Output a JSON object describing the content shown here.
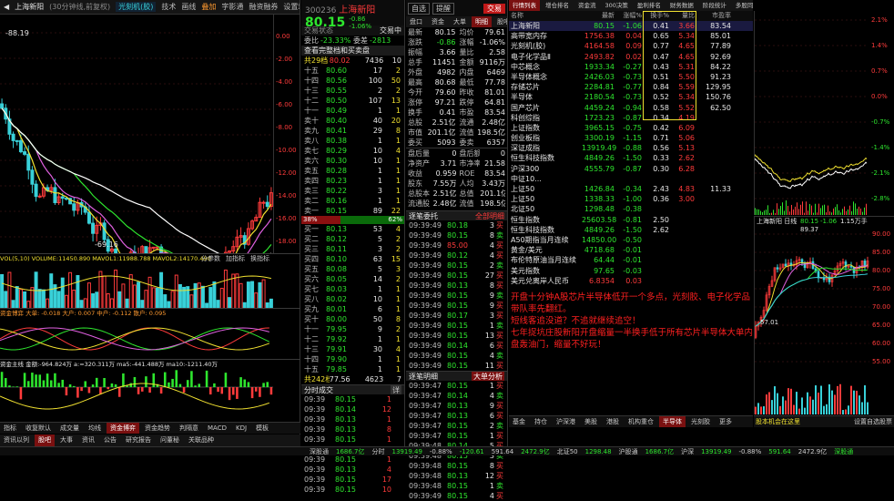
{
  "colors": {
    "up": "#ff3b3b",
    "down": "#2ee62e",
    "bg": "#000000",
    "accent": "#7a1010",
    "notes": "#ff2020"
  },
  "left": {
    "toolbar": [
      "上海新阳",
      "(30分钟线,前复权)",
      "光刻机(胶)",
      "技术",
      "画线",
      "叠加",
      "字影通",
      "融资融券",
      "设置均线"
    ],
    "toolbar_left_tab": "上海新阳",
    "kline_top_label": "-88.19",
    "kline_low_label": "-69.16",
    "right_axis": [
      "0.00",
      "-2.00",
      "-4.00",
      "-6.00",
      "-8.00",
      "-10.00",
      "-12.00",
      "-14.00",
      "-16.00",
      "-18.00"
    ],
    "vol_header": "VOL(5,10)  VOLUME:11450.890  MAVOL1:11988.788  MAVOL2:14170.490",
    "vol_axis": [
      "50000",
      "40000",
      "30000",
      "20000",
      "10000"
    ],
    "vol_buttons": [
      "分参数",
      "加指标",
      "换指标"
    ],
    "flow_header": "资金博弈  大单: -0.018  大户: 0.007  中户: -0.112  散户: 0.095",
    "flow_axis": [
      "3000",
      "2000",
      "1000",
      "0",
      "-1000",
      "-2000"
    ],
    "amt_header": "资金主线  金额:-964.824万  a:=320.311万  ma5:-441.488万  ma10:-1211.40万",
    "amt_axis": [
      "1000",
      "0",
      "-1000",
      "-2000",
      "-3000",
      "-4000",
      "-4610.00"
    ],
    "bottom_tabs": [
      "指标",
      "收复默认",
      "成交量",
      "均线",
      "资金博弈",
      "资金趋势",
      "判隔意",
      "MACD",
      "KDJ",
      "模板"
    ],
    "bottom_nav": [
      "资讯以列",
      "股吧",
      "大事",
      "资讯",
      "公告",
      "研究报告",
      "问董秘",
      "关联品种"
    ]
  },
  "quote": {
    "code": "300236",
    "name": "上海新阳",
    "price": "80.15",
    "change": "-0.86",
    "pct": "-1.06%",
    "tab": "交易",
    "state": "交易状态",
    "state_val": "交易中",
    "ratio_label": "委比",
    "ratio_val": "-23.33%",
    "diff_label": "委差",
    "diff_val": "-2813",
    "link": "查看完整档和买卖盘",
    "mid_label": "共29档",
    "mid_price": "80.02",
    "mid_vol": "7436",
    "mid_n": "10",
    "asks": [
      [
        "十五",
        "80.60",
        "17",
        "2"
      ],
      [
        "十四",
        "80.56",
        "100",
        "50"
      ],
      [
        "十三",
        "80.55",
        "2",
        "2"
      ],
      [
        "十二",
        "80.50",
        "107",
        "13"
      ],
      [
        "十一",
        "80.49",
        "1",
        "1"
      ],
      [
        "卖十",
        "80.40",
        "40",
        "20"
      ],
      [
        "卖九",
        "80.41",
        "29",
        "8"
      ],
      [
        "卖八",
        "80.38",
        "1",
        "1"
      ],
      [
        "卖七",
        "80.29",
        "10",
        "4"
      ],
      [
        "卖六",
        "80.30",
        "10",
        "1"
      ],
      [
        "卖五",
        "80.28",
        "1",
        "1"
      ],
      [
        "卖四",
        "80.23",
        "1",
        "1"
      ],
      [
        "卖三",
        "80.22",
        "3",
        "1"
      ],
      [
        "卖二",
        "80.16",
        "1",
        "1"
      ],
      [
        "卖一",
        "80.15",
        "89",
        "22"
      ]
    ],
    "balance": [
      "38%",
      "62%"
    ],
    "bids": [
      [
        "买一",
        "80.13",
        "53",
        "4"
      ],
      [
        "买二",
        "80.12",
        "5",
        "2"
      ],
      [
        "买三",
        "80.11",
        "3",
        "2"
      ],
      [
        "买四",
        "80.10",
        "63",
        "15"
      ],
      [
        "买五",
        "80.08",
        "5",
        "3"
      ],
      [
        "买六",
        "80.05",
        "14",
        "2"
      ],
      [
        "买七",
        "80.03",
        "1",
        "1"
      ],
      [
        "买八",
        "80.02",
        "10",
        "1"
      ],
      [
        "买九",
        "80.01",
        "6",
        "1"
      ],
      [
        "买十",
        "80.00",
        "50",
        "8"
      ],
      [
        "十一",
        "79.95",
        "9",
        "2"
      ],
      [
        "十二",
        "79.92",
        "1",
        "1"
      ],
      [
        "十三",
        "79.91",
        "30",
        "4"
      ],
      [
        "十四",
        "79.90",
        "1",
        "1"
      ],
      [
        "十五",
        "79.85",
        "1",
        "1"
      ]
    ],
    "bid_total": [
      "共242档",
      "77.56",
      "4623",
      "7"
    ],
    "trades_title": "分时成交",
    "trades_btn": "详",
    "trades": [
      [
        "09:39",
        "80.15",
        "1"
      ],
      [
        "09:39",
        "80.14",
        "12"
      ],
      [
        "09:39",
        "80.13",
        "1"
      ],
      [
        "09:39",
        "80.13",
        "8"
      ],
      [
        "09:39",
        "80.15",
        "1"
      ],
      [
        "09:39",
        "80.14",
        "2"
      ],
      [
        "09:39",
        "80.15",
        "1"
      ],
      [
        "09:39",
        "80.13",
        "4"
      ],
      [
        "09:39",
        "80.15",
        "17"
      ],
      [
        "09:39",
        "80.15",
        "10"
      ]
    ]
  },
  "mid": {
    "self_pick": "自选",
    "remind": "提醒",
    "trade_btn": "交易",
    "tabs": [
      "盘口",
      "资金",
      "大单",
      "明细",
      "股吧",
      "更多"
    ],
    "stats": [
      [
        "最新",
        "80.15",
        "均价",
        "79.61"
      ],
      [
        "涨跌",
        "-0.86",
        "涨幅",
        "-1.06%"
      ],
      [
        "振幅",
        "3.66",
        "量比",
        "2.58"
      ],
      [
        "总手",
        "11451",
        "金额",
        "9116万"
      ],
      [
        "外盘",
        "4982",
        "内盘",
        "6469"
      ],
      [
        "最高",
        "80.68",
        "最低",
        "77.78"
      ],
      [
        "今开",
        "79.60",
        "昨收",
        "81.01"
      ],
      [
        "涨停",
        "97.21",
        "跌停",
        "64.81"
      ],
      [
        "换手",
        "0.41",
        "市盈",
        "83.54"
      ],
      [
        "总股",
        "2.51亿",
        "流通",
        "2.48亿"
      ],
      [
        "市值",
        "201.1亿",
        "流值",
        "198.5亿"
      ],
      [
        "委买",
        "5093",
        "委卖",
        "6357"
      ]
    ],
    "extra": [
      [
        "盘后量",
        "0",
        "盘后额",
        "0"
      ],
      [
        "净资产",
        "3.71",
        "市净率",
        "21.58"
      ],
      [
        "收益",
        "0.959",
        "ROE",
        "83.54"
      ],
      [
        "股东",
        "7.55万",
        "人均",
        "3.43万"
      ],
      [
        "总股本",
        "2.51亿",
        "总值",
        "201.1亿"
      ],
      [
        "流通股",
        "2.48亿",
        "流值",
        "198.5亿"
      ]
    ],
    "detail_title": "逐笔委托",
    "detail_btn": "全部明细",
    "detail": [
      [
        "09:39:49",
        "80.18",
        "3"
      ],
      [
        "09:39:49",
        "80.15",
        "8"
      ],
      [
        "09:39:49",
        "85.00",
        "4"
      ],
      [
        "09:39:49",
        "80.12",
        "4"
      ],
      [
        "09:39:49",
        "80.15",
        "2"
      ],
      [
        "09:39:49",
        "80.15",
        "27"
      ],
      [
        "09:39:49",
        "80.13",
        "8"
      ],
      [
        "09:39:49",
        "80.15",
        "9"
      ],
      [
        "09:39:49",
        "80.15",
        "9"
      ],
      [
        "09:39:49",
        "80.17",
        "3"
      ],
      [
        "09:39:49",
        "80.15",
        "1"
      ],
      [
        "09:39:49",
        "80.15",
        "13"
      ],
      [
        "09:39:49",
        "80.14",
        "6"
      ],
      [
        "09:39:49",
        "80.15",
        "4"
      ],
      [
        "09:39:49",
        "80.15",
        "11"
      ]
    ],
    "detail2_title": "逐笔明细",
    "detail2_btn": "大单分析",
    "detail2": [
      [
        "09:39:47",
        "80.15",
        "1"
      ],
      [
        "09:39:47",
        "80.14",
        "4"
      ],
      [
        "09:39:47",
        "80.13",
        "9"
      ],
      [
        "09:39:47",
        "80.13",
        "6"
      ],
      [
        "09:39:47",
        "80.15",
        "2"
      ],
      [
        "09:39:47",
        "80.15",
        "1"
      ],
      [
        "09:39:48",
        "80.14",
        "5"
      ],
      [
        "09:39:48",
        "80.15",
        "3"
      ],
      [
        "09:39:48",
        "80.15",
        "8"
      ],
      [
        "09:39:48",
        "80.13",
        "12"
      ],
      [
        "09:39:48",
        "80.15",
        "1"
      ],
      [
        "09:39:49",
        "80.15",
        "4"
      ]
    ]
  },
  "table": {
    "tabs": [
      "行情列表",
      "增仓排名",
      "资金流",
      "300决策",
      "盈利排名",
      "财务数据",
      "阶段统计",
      "多股同列"
    ],
    "cols": [
      "名称",
      "最新",
      "涨幅%",
      "换手%",
      "量比",
      "市盈率"
    ],
    "rows": [
      [
        "上海新阳",
        "80.15",
        "-1.06",
        "0.41",
        "3.66",
        "83.54"
      ],
      [
        "高带宽内存",
        "1756.38",
        "0.04",
        "0.65",
        "5.34",
        "85.01"
      ],
      [
        "光刻机(胶)",
        "4164.58",
        "0.09",
        "0.77",
        "4.65",
        "77.89"
      ],
      [
        "电子化学品Ⅱ",
        "2493.82",
        "0.02",
        "0.47",
        "4.65",
        "92.69"
      ],
      [
        "中芯概念",
        "1933.34",
        "-0.27",
        "0.43",
        "5.31",
        "84.22"
      ],
      [
        "半导体概念",
        "2426.03",
        "-0.73",
        "0.51",
        "5.50",
        "91.23"
      ],
      [
        "存储芯片",
        "2284.81",
        "-0.77",
        "0.84",
        "5.59",
        "129.95"
      ],
      [
        "半导体",
        "2180.54",
        "-0.73",
        "0.52",
        "5.34",
        "150.76"
      ],
      [
        "国产芯片",
        "4459.24",
        "-0.94",
        "0.58",
        "5.52",
        "62.50"
      ],
      [
        "科创综指",
        "1723.23",
        "-0.87",
        "0.34",
        "4.19",
        ""
      ],
      [
        "上证指数",
        "3965.15",
        "-0.75",
        "0.42",
        "6.09",
        ""
      ],
      [
        "创业板指",
        "3300.19",
        "-1.15",
        "0.71",
        "5.06",
        ""
      ],
      [
        "深证成指",
        "13919.49",
        "-0.88",
        "0.56",
        "5.13",
        ""
      ],
      [
        "恒生科技指数",
        "4849.26",
        "-1.50",
        "0.33",
        "2.62",
        ""
      ],
      [
        "沪深300",
        "4555.79",
        "-0.87",
        "0.30",
        "6.28",
        ""
      ],
      [
        "中证10...",
        "",
        "",
        "",
        "",
        ""
      ],
      [
        "上证50",
        "1426.84",
        "-0.34",
        "2.43",
        "4.83",
        "11.33"
      ],
      [
        "上证50",
        "1338.33",
        "-1.00",
        "0.36",
        "3.00",
        ""
      ],
      [
        "北证50",
        "1298.48",
        "-0.38",
        "",
        "",
        ""
      ],
      [
        "恒生指数",
        "25603.58",
        "-0.81",
        "2.50",
        "",
        ""
      ],
      [
        "恒生科技指数",
        "4849.26",
        "-1.50",
        "2.62",
        "",
        ""
      ],
      [
        "A50期指当月连续",
        "14850.00",
        "-0.50",
        "",
        "",
        ""
      ],
      [
        "黄金/美元",
        "4718.68",
        "-0.01",
        "",
        "",
        ""
      ],
      [
        "布伦特原油当月连续",
        "64.44",
        "-0.01",
        "",
        "",
        ""
      ],
      [
        "美元指数",
        "97.65",
        "-0.03",
        "",
        "",
        ""
      ],
      [
        "美元兑离岸人民币",
        "6.8354",
        "0.03",
        "",
        "",
        ""
      ]
    ],
    "notes": "开盘十分钟A股芯片半导体低开一个多点，光刻胶、电子化学品带队率先翻红。\n短线客追没道？不追就继续追空！\n七年捉坑庄股新阳开盘缩量一半换手低于所有芯片半导体大单内盘轰油门，缩量不好玩！",
    "bottom_tabs": [
      "基金",
      "持仓",
      "沪深港",
      "美股",
      "港股",
      "机构重仓",
      "半导体",
      "光刻胶",
      "更多"
    ],
    "bottom_tab_active": "半导体"
  },
  "mini": {
    "axis": [
      "2.1%",
      "1.4%",
      "0.7%",
      "0.0%",
      "-0.7%",
      "-1.4%",
      "-2.1%",
      "-2.8%"
    ],
    "times": [
      "09:30",
      "10:30",
      "11:30/13:00",
      "14:00",
      "15:00"
    ],
    "title": "上海新阳 日线",
    "price": "80.15",
    "pct": "-1.06",
    "range": "1.15万手",
    "high_label": "89.37",
    "low_label": "57.01",
    "kaxis": [
      "90.00",
      "85.00",
      "80.00",
      "75.00",
      "70.00",
      "65.00",
      "60.00",
      "55.00"
    ],
    "years": [
      "2026",
      "02",
      "03",
      "04"
    ],
    "links": [
      "股本机会在这里",
      "设置自选股票"
    ]
  },
  "status": {
    "items": [
      [
        "深股通",
        "1686.7亿"
      ],
      [
        "分时",
        "13919.49"
      ],
      [
        "-0.88%",
        "-120.61"
      ],
      [
        "591.64",
        "2472.9亿"
      ],
      [
        "北证50",
        "1298.48"
      ]
    ],
    "items2": [
      [
        "沪股通",
        "1686.7亿"
      ],
      [
        "沪深",
        "13919.49"
      ],
      [
        "-0.88%",
        "591.64"
      ],
      [
        "2472.9亿",
        "深股通"
      ]
    ]
  }
}
